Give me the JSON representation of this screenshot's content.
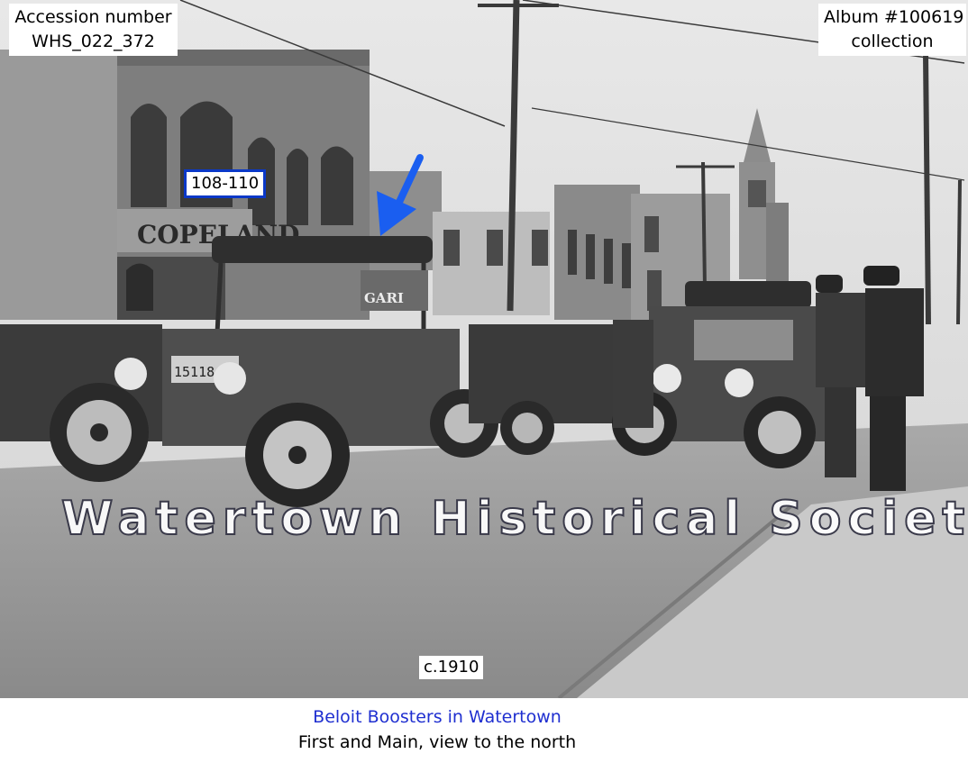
{
  "photo": {
    "subject": "vintage-street-scene",
    "arrow_color": "#1a5ef0",
    "accession_label": "Accession number",
    "accession_number": "WHS_022_372",
    "album_label": "Album #100619",
    "album_sub": "collection",
    "address_tag": "108-110",
    "date_tag": "c.1910",
    "watermark": "Watertown Historical Society",
    "sign_text_1": "COPELAND",
    "sign_text_2": "GARI"
  },
  "caption": {
    "title": "Beloit Boosters in Watertown",
    "subtitle": "First and Main, view to the north",
    "title_color": "#1f2fd0"
  }
}
